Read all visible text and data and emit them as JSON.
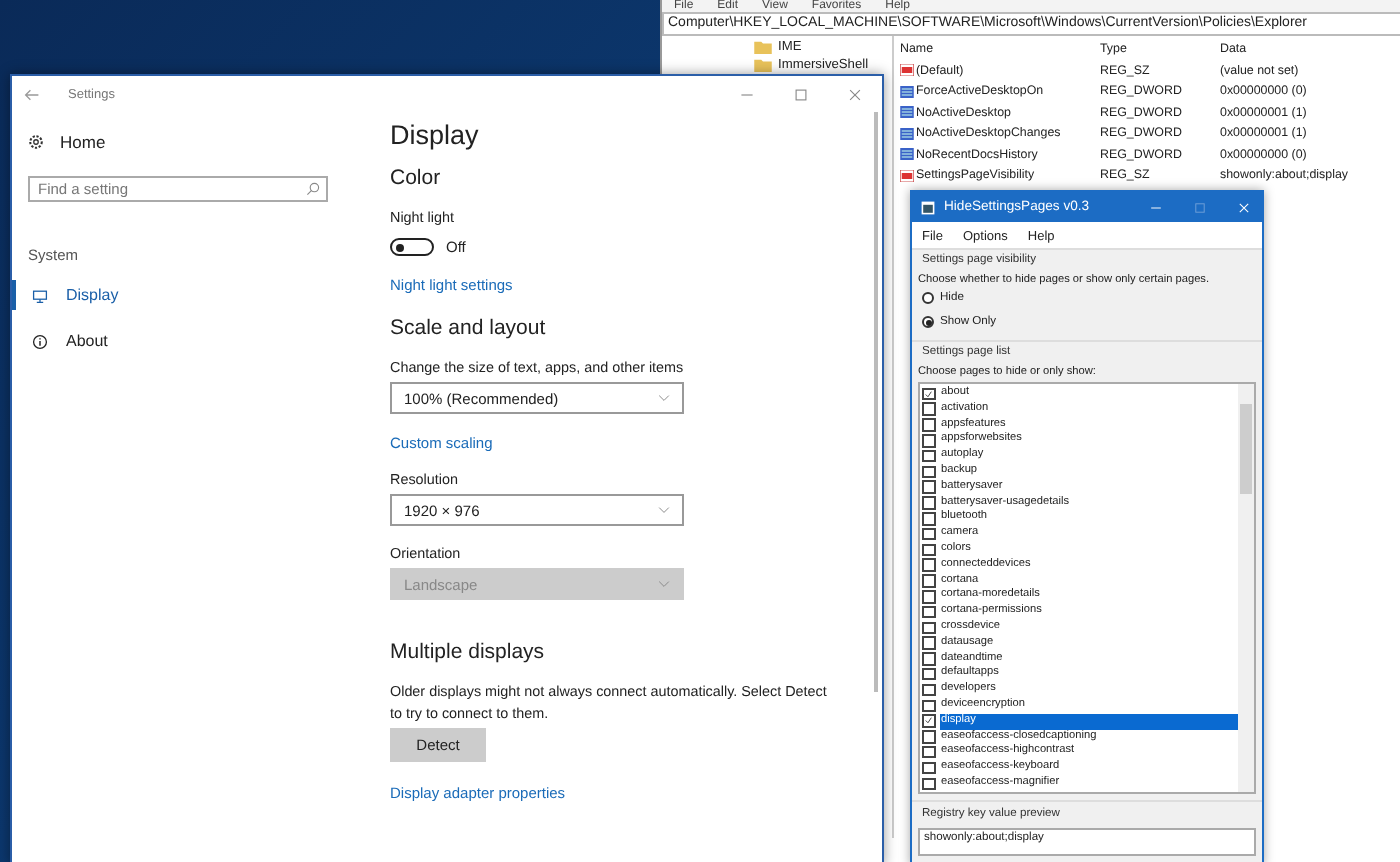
{
  "registry_editor": {
    "menu": [
      "File",
      "Edit",
      "View",
      "Favorites",
      "Help"
    ],
    "address": "Computer\\HKEY_LOCAL_MACHINE\\SOFTWARE\\Microsoft\\Windows\\CurrentVersion\\Policies\\Explorer",
    "tree": [
      {
        "label": "IME"
      },
      {
        "label": "ImmersiveShell"
      }
    ],
    "columns": [
      "Name",
      "Type",
      "Data"
    ],
    "rows": [
      {
        "kind": "string",
        "name": "(Default)",
        "type": "REG_SZ",
        "data": "(value not set)"
      },
      {
        "kind": "dword",
        "name": "ForceActiveDesktopOn",
        "type": "REG_DWORD",
        "data": "0x00000000 (0)"
      },
      {
        "kind": "dword",
        "name": "NoActiveDesktop",
        "type": "REG_DWORD",
        "data": "0x00000001 (1)"
      },
      {
        "kind": "dword",
        "name": "NoActiveDesktopChanges",
        "type": "REG_DWORD",
        "data": "0x00000001 (1)"
      },
      {
        "kind": "dword",
        "name": "NoRecentDocsHistory",
        "type": "REG_DWORD",
        "data": "0x00000000 (0)"
      },
      {
        "kind": "string",
        "name": "SettingsPageVisibility",
        "type": "REG_SZ",
        "data": "showonly:about;display"
      }
    ]
  },
  "settings": {
    "title": "Settings",
    "home": "Home",
    "search": {
      "placeholder": "Find a setting"
    },
    "section": "System",
    "nav": [
      {
        "kind": "display",
        "label": "Display",
        "selected": true
      },
      {
        "kind": "about",
        "label": "About",
        "selected": false
      }
    ],
    "page_title": "Display",
    "color_heading": "Color",
    "night_light": {
      "label": "Night light",
      "on": false,
      "state_text": "Off"
    },
    "night_light_link": "Night light settings",
    "scale_heading": "Scale and layout",
    "size_label": "Change the size of text, apps, and other items",
    "size_dropdown": {
      "value": "100% (Recommended)",
      "disabled": false
    },
    "custom_scaling_link": "Custom scaling",
    "resolution_label": "Resolution",
    "resolution_dropdown": {
      "value": "1920 × 976",
      "disabled": false
    },
    "orientation_label": "Orientation",
    "orientation_dropdown": {
      "value": "Landscape",
      "disabled": true
    },
    "multiple_heading": "Multiple displays",
    "multiple_text": "Older displays might not always connect automatically. Select Detect to try to connect to them.",
    "detect_button": "Detect",
    "adapter_link": "Display adapter properties"
  },
  "hide_settings_pages": {
    "title": "HideSettingsPages v0.3",
    "menu": [
      "File",
      "Options",
      "Help"
    ],
    "visibility_group": "Settings page visibility",
    "visibility_text": "Choose whether to hide pages or show only certain pages.",
    "modes": [
      {
        "label": "Hide",
        "selected": false
      },
      {
        "label": "Show Only",
        "selected": true
      }
    ],
    "list_group": "Settings page list",
    "list_text": "Choose pages to hide or only show:",
    "pages": [
      {
        "label": "about",
        "checked": true,
        "selected": false
      },
      {
        "label": "activation",
        "checked": false,
        "selected": false
      },
      {
        "label": "appsfeatures",
        "checked": false,
        "selected": false
      },
      {
        "label": "appsforwebsites",
        "checked": false,
        "selected": false
      },
      {
        "label": "autoplay",
        "checked": false,
        "selected": false
      },
      {
        "label": "backup",
        "checked": false,
        "selected": false
      },
      {
        "label": "batterysaver",
        "checked": false,
        "selected": false
      },
      {
        "label": "batterysaver-usagedetails",
        "checked": false,
        "selected": false
      },
      {
        "label": "bluetooth",
        "checked": false,
        "selected": false
      },
      {
        "label": "camera",
        "checked": false,
        "selected": false
      },
      {
        "label": "colors",
        "checked": false,
        "selected": false
      },
      {
        "label": "connecteddevices",
        "checked": false,
        "selected": false
      },
      {
        "label": "cortana",
        "checked": false,
        "selected": false
      },
      {
        "label": "cortana-moredetails",
        "checked": false,
        "selected": false
      },
      {
        "label": "cortana-permissions",
        "checked": false,
        "selected": false
      },
      {
        "label": "crossdevice",
        "checked": false,
        "selected": false
      },
      {
        "label": "datausage",
        "checked": false,
        "selected": false
      },
      {
        "label": "dateandtime",
        "checked": false,
        "selected": false
      },
      {
        "label": "defaultapps",
        "checked": false,
        "selected": false
      },
      {
        "label": "developers",
        "checked": false,
        "selected": false
      },
      {
        "label": "deviceencryption",
        "checked": false,
        "selected": false
      },
      {
        "label": "display",
        "checked": true,
        "selected": true
      },
      {
        "label": "easeofaccess-closedcaptioning",
        "checked": false,
        "selected": false
      },
      {
        "label": "easeofaccess-highcontrast",
        "checked": false,
        "selected": false
      },
      {
        "label": "easeofaccess-keyboard",
        "checked": false,
        "selected": false
      },
      {
        "label": "easeofaccess-magnifier",
        "checked": false,
        "selected": false
      }
    ],
    "preview_group": "Registry key value preview",
    "preview_value": "showonly:about;display"
  }
}
